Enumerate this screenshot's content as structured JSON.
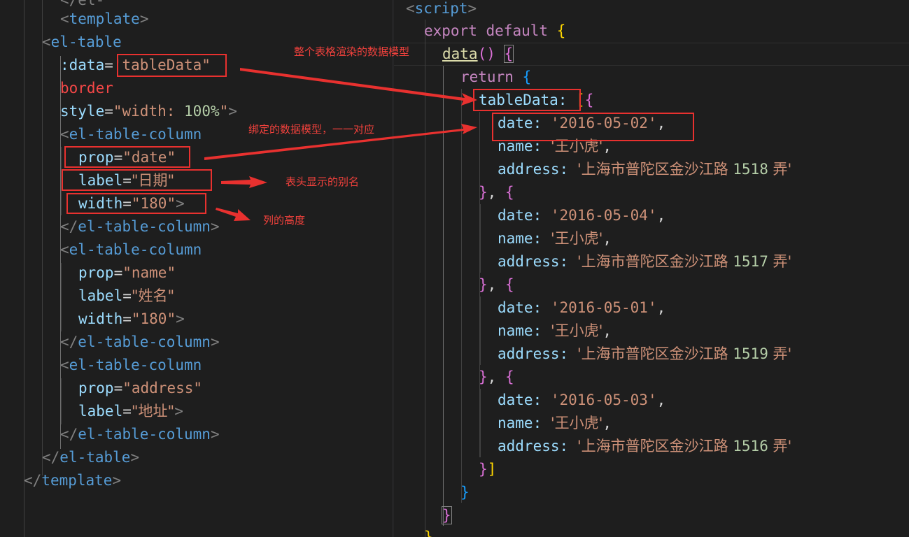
{
  "left_code": {
    "l0_partial": "</el-",
    "template_open": "template",
    "el_table_open": "el-table",
    "data_attr": ":data",
    "data_value": "'tableData\"",
    "border_attr": "border",
    "style_attr": "style",
    "style_value_a": "\"width: ",
    "style_value_num": "100%",
    "style_value_b": "\"",
    "column_tag": "el-table-column",
    "prop_attr": "prop",
    "label_attr": "label",
    "width_attr": "width",
    "col1": {
      "prop": "\"date\"",
      "label": "\"日期\"",
      "width": "\"180\""
    },
    "col2": {
      "prop": "\"name\"",
      "label": "\"姓名\"",
      "width": "\"180\""
    },
    "col3": {
      "prop": "\"address\"",
      "label": "\"地址\""
    },
    "el_table_close": "el-table",
    "template_close": "template"
  },
  "right_code": {
    "script_tag": "script",
    "export_kw": "export",
    "default_kw": "default",
    "data_fn": "data",
    "return_kw": "return",
    "table_key": "tableData:",
    "date_key": "date:",
    "name_key": "name:",
    "address_key": "address:",
    "rows": [
      {
        "date": "'2016-05-02'",
        "name": "'王小虎'",
        "address_text": "'上海市普陀区金沙江路 ",
        "address_num": "1518",
        "address_end": " 弄'"
      },
      {
        "date": "'2016-05-04'",
        "name": "'王小虎'",
        "address_text": "'上海市普陀区金沙江路 ",
        "address_num": "1517",
        "address_end": " 弄'"
      },
      {
        "date": "'2016-05-01'",
        "name": "'王小虎'",
        "address_text": "'上海市普陀区金沙江路 ",
        "address_num": "1519",
        "address_end": " 弄'"
      },
      {
        "date": "'2016-05-03'",
        "name": "'王小虎'",
        "address_text": "'上海市普陀区金沙江路 ",
        "address_num": "1516",
        "address_end": " 弄'"
      }
    ]
  },
  "annotations": {
    "model_note": "整个表格渲染的数据模型",
    "binding_note": "绑定的数据模型，一一对应",
    "header_note": "表头显示的别名",
    "width_note": "列的高度"
  },
  "colors": {
    "background": "#1e1e1e",
    "annotation_red": "#e8312f",
    "tag_blue": "#569cd6",
    "attr_lightblue": "#9cdcfe",
    "string_orange": "#ce9178"
  }
}
